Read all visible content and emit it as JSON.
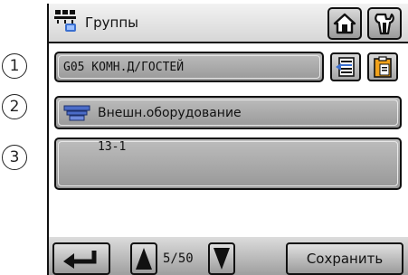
{
  "header": {
    "title": "Группы"
  },
  "callouts": [
    "1",
    "2",
    "3"
  ],
  "group_field": {
    "value": "G05 КОМН.Д/ГОСТЕЙ"
  },
  "equipment_field": {
    "value": "Внешн.оборудование"
  },
  "item_field": {
    "value": "13-1"
  },
  "footer": {
    "page": "5/50",
    "save_label": "Сохранить"
  },
  "colors": {
    "field_gray": "#a8a8a8",
    "accent_orange": "#f1a21b",
    "accent_blue": "#4b6cc8"
  },
  "icons": [
    "network-group-icon",
    "home-icon",
    "wrench-icon",
    "edit-list-icon",
    "clipboard-icon",
    "equipment-icon",
    "enter-return-icon",
    "page-up-icon",
    "page-down-icon"
  ]
}
